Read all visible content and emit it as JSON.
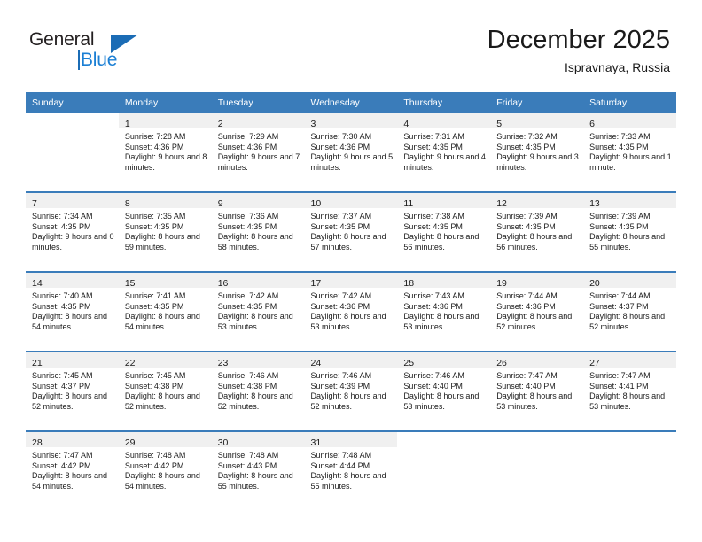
{
  "brand": {
    "name_top": "General",
    "name_bottom": "Blue",
    "accent_color": "#1b6cb5",
    "blue_text_color": "#1b7fd4"
  },
  "header": {
    "title": "December 2025",
    "subtitle": "Ispravnaya, Russia"
  },
  "theme": {
    "header_bg": "#3a7cba",
    "daynum_bg": "#f0f0f0",
    "text": "#1a1a1a"
  },
  "calendar": {
    "weekday_headers": [
      "Sunday",
      "Monday",
      "Tuesday",
      "Wednesday",
      "Thursday",
      "Friday",
      "Saturday"
    ],
    "labels": {
      "sunrise": "Sunrise:",
      "sunset": "Sunset:",
      "daylight": "Daylight:"
    },
    "weeks": [
      [
        {
          "day": "",
          "sunrise": "",
          "sunset": "",
          "daylight": ""
        },
        {
          "day": "1",
          "sunrise": "Sunrise: 7:28 AM",
          "sunset": "Sunset: 4:36 PM",
          "daylight": "Daylight: 9 hours and 8 minutes."
        },
        {
          "day": "2",
          "sunrise": "Sunrise: 7:29 AM",
          "sunset": "Sunset: 4:36 PM",
          "daylight": "Daylight: 9 hours and 7 minutes."
        },
        {
          "day": "3",
          "sunrise": "Sunrise: 7:30 AM",
          "sunset": "Sunset: 4:36 PM",
          "daylight": "Daylight: 9 hours and 5 minutes."
        },
        {
          "day": "4",
          "sunrise": "Sunrise: 7:31 AM",
          "sunset": "Sunset: 4:35 PM",
          "daylight": "Daylight: 9 hours and 4 minutes."
        },
        {
          "day": "5",
          "sunrise": "Sunrise: 7:32 AM",
          "sunset": "Sunset: 4:35 PM",
          "daylight": "Daylight: 9 hours and 3 minutes."
        },
        {
          "day": "6",
          "sunrise": "Sunrise: 7:33 AM",
          "sunset": "Sunset: 4:35 PM",
          "daylight": "Daylight: 9 hours and 1 minute."
        }
      ],
      [
        {
          "day": "7",
          "sunrise": "Sunrise: 7:34 AM",
          "sunset": "Sunset: 4:35 PM",
          "daylight": "Daylight: 9 hours and 0 minutes."
        },
        {
          "day": "8",
          "sunrise": "Sunrise: 7:35 AM",
          "sunset": "Sunset: 4:35 PM",
          "daylight": "Daylight: 8 hours and 59 minutes."
        },
        {
          "day": "9",
          "sunrise": "Sunrise: 7:36 AM",
          "sunset": "Sunset: 4:35 PM",
          "daylight": "Daylight: 8 hours and 58 minutes."
        },
        {
          "day": "10",
          "sunrise": "Sunrise: 7:37 AM",
          "sunset": "Sunset: 4:35 PM",
          "daylight": "Daylight: 8 hours and 57 minutes."
        },
        {
          "day": "11",
          "sunrise": "Sunrise: 7:38 AM",
          "sunset": "Sunset: 4:35 PM",
          "daylight": "Daylight: 8 hours and 56 minutes."
        },
        {
          "day": "12",
          "sunrise": "Sunrise: 7:39 AM",
          "sunset": "Sunset: 4:35 PM",
          "daylight": "Daylight: 8 hours and 56 minutes."
        },
        {
          "day": "13",
          "sunrise": "Sunrise: 7:39 AM",
          "sunset": "Sunset: 4:35 PM",
          "daylight": "Daylight: 8 hours and 55 minutes."
        }
      ],
      [
        {
          "day": "14",
          "sunrise": "Sunrise: 7:40 AM",
          "sunset": "Sunset: 4:35 PM",
          "daylight": "Daylight: 8 hours and 54 minutes."
        },
        {
          "day": "15",
          "sunrise": "Sunrise: 7:41 AM",
          "sunset": "Sunset: 4:35 PM",
          "daylight": "Daylight: 8 hours and 54 minutes."
        },
        {
          "day": "16",
          "sunrise": "Sunrise: 7:42 AM",
          "sunset": "Sunset: 4:35 PM",
          "daylight": "Daylight: 8 hours and 53 minutes."
        },
        {
          "day": "17",
          "sunrise": "Sunrise: 7:42 AM",
          "sunset": "Sunset: 4:36 PM",
          "daylight": "Daylight: 8 hours and 53 minutes."
        },
        {
          "day": "18",
          "sunrise": "Sunrise: 7:43 AM",
          "sunset": "Sunset: 4:36 PM",
          "daylight": "Daylight: 8 hours and 53 minutes."
        },
        {
          "day": "19",
          "sunrise": "Sunrise: 7:44 AM",
          "sunset": "Sunset: 4:36 PM",
          "daylight": "Daylight: 8 hours and 52 minutes."
        },
        {
          "day": "20",
          "sunrise": "Sunrise: 7:44 AM",
          "sunset": "Sunset: 4:37 PM",
          "daylight": "Daylight: 8 hours and 52 minutes."
        }
      ],
      [
        {
          "day": "21",
          "sunrise": "Sunrise: 7:45 AM",
          "sunset": "Sunset: 4:37 PM",
          "daylight": "Daylight: 8 hours and 52 minutes."
        },
        {
          "day": "22",
          "sunrise": "Sunrise: 7:45 AM",
          "sunset": "Sunset: 4:38 PM",
          "daylight": "Daylight: 8 hours and 52 minutes."
        },
        {
          "day": "23",
          "sunrise": "Sunrise: 7:46 AM",
          "sunset": "Sunset: 4:38 PM",
          "daylight": "Daylight: 8 hours and 52 minutes."
        },
        {
          "day": "24",
          "sunrise": "Sunrise: 7:46 AM",
          "sunset": "Sunset: 4:39 PM",
          "daylight": "Daylight: 8 hours and 52 minutes."
        },
        {
          "day": "25",
          "sunrise": "Sunrise: 7:46 AM",
          "sunset": "Sunset: 4:40 PM",
          "daylight": "Daylight: 8 hours and 53 minutes."
        },
        {
          "day": "26",
          "sunrise": "Sunrise: 7:47 AM",
          "sunset": "Sunset: 4:40 PM",
          "daylight": "Daylight: 8 hours and 53 minutes."
        },
        {
          "day": "27",
          "sunrise": "Sunrise: 7:47 AM",
          "sunset": "Sunset: 4:41 PM",
          "daylight": "Daylight: 8 hours and 53 minutes."
        }
      ],
      [
        {
          "day": "28",
          "sunrise": "Sunrise: 7:47 AM",
          "sunset": "Sunset: 4:42 PM",
          "daylight": "Daylight: 8 hours and 54 minutes."
        },
        {
          "day": "29",
          "sunrise": "Sunrise: 7:48 AM",
          "sunset": "Sunset: 4:42 PM",
          "daylight": "Daylight: 8 hours and 54 minutes."
        },
        {
          "day": "30",
          "sunrise": "Sunrise: 7:48 AM",
          "sunset": "Sunset: 4:43 PM",
          "daylight": "Daylight: 8 hours and 55 minutes."
        },
        {
          "day": "31",
          "sunrise": "Sunrise: 7:48 AM",
          "sunset": "Sunset: 4:44 PM",
          "daylight": "Daylight: 8 hours and 55 minutes."
        },
        {
          "day": "",
          "sunrise": "",
          "sunset": "",
          "daylight": ""
        },
        {
          "day": "",
          "sunrise": "",
          "sunset": "",
          "daylight": ""
        },
        {
          "day": "",
          "sunrise": "",
          "sunset": "",
          "daylight": ""
        }
      ]
    ]
  }
}
